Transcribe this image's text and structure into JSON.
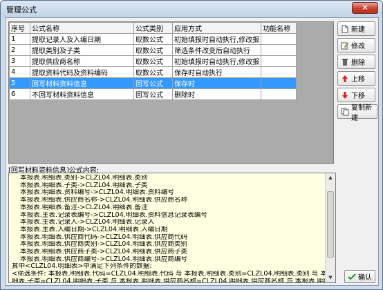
{
  "window": {
    "title": "管理公式",
    "close_glyph": "✕"
  },
  "table": {
    "headers": [
      "序号",
      "公式名称",
      "公式类别",
      "应用方式",
      "功能名称"
    ],
    "rows": [
      [
        "1",
        "提取记录人及入编日期",
        "取数公式",
        "初始填报时自动执行,修改报",
        ""
      ],
      [
        "2",
        "提取类别及子类",
        "取数公式",
        "筛选条件改变后自动执行",
        ""
      ],
      [
        "3",
        "提取供应商名称",
        "取数公式",
        "初始填报时自动执行,修改报",
        ""
      ],
      [
        "4",
        "提取资料代码及资料编码",
        "取数公式",
        "保存时自动执行",
        ""
      ],
      [
        "5",
        "回写材料资料信息",
        "回写公式",
        "保存时",
        ""
      ],
      [
        "6",
        "不回写材料资料信息",
        "回写公式",
        "删除时",
        ""
      ]
    ],
    "selected_row": 5
  },
  "buttons": {
    "new": "新建",
    "edit": "修改",
    "delete": "删除",
    "move_up": "上移",
    "move_down": "下移",
    "copy_new": "复制新建"
  },
  "description": {
    "label": "[回写材料资料信息]公式内容:",
    "lines": [
      "本报表.明细表.类别->CLZL04.明细表.类别",
      "本报表.明细表.子类->CLZL04.明细表.子类",
      "本报表.明细表.资料编号->CLZL04.明细表.资料编号",
      "本报表.明细表.供应商名称->CLZL04.明细表.供应商名称",
      "本报表.明细表.备注->CLZL04.明细表.备注",
      "本报表.主表.记录表编号->CLZL04.明细表.资料信息记录表编号",
      "本报表.主表.记录人->CLZL04.明细表.记录人",
      "本报表.主表.入编日期->CLZL04.明细表.入编日期",
      "本报表.明细表.供应商代码->CLZL04.明细表.供应商代码",
      "本报表.明细表.供应商类别->CLZL04.明细表.供应商类别",
      "本报表.明细表.供应商子类->CLZL04.明细表.供应商子类",
      "本报表.明细表.供应商编号->CLZL04.明细表.供应商编号",
      "其中<CLZL04.明细表>中满足下列条件的数据:",
      "<筛选条件: 本报表.明细表.代码=CLZL04.明细表.代码 与 本报表.明细表.类别=CLZL04.明细表.类别 与 本报表.明",
      "细表.子类=CLZL04.明细表.子类 与 本报表.明细表.供应商名称=CLZL04.明细表.供应商名称 与 本报表.明细表.备注",
      "=CLZL04.明细表.备注 与 本报表.明细表.供应商代码=CLZL04.明细表.供应商代码 与 本报表.明细表.供应商类别"
    ]
  },
  "ok_button": "确认",
  "icons": {
    "new": "new-document-icon",
    "edit": "edit-icon",
    "delete": "delete-icon",
    "move_up": "arrow-up-icon",
    "move_down": "arrow-down-icon",
    "copy_new": "copy-icon",
    "ok": "checkmark-icon"
  },
  "colors": {
    "selection": "#3399ff",
    "text_area_bg": "#ffffe1",
    "close_button": "#c7402e"
  }
}
